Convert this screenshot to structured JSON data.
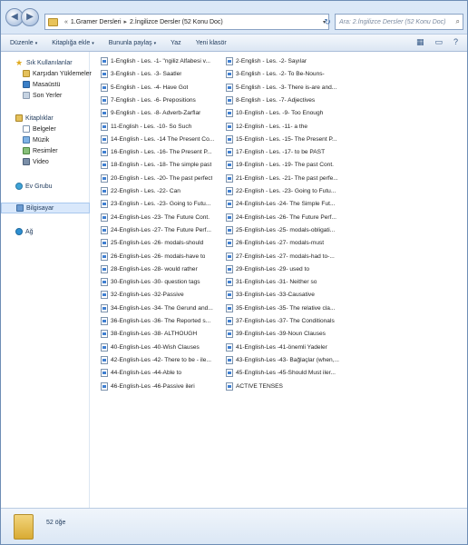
{
  "navbar": {
    "back_glyph": "◀",
    "forward_glyph": "▶",
    "address": {
      "prefix": "«",
      "crumbs": [
        "1.Gramer Dersleri",
        "2.İngilizce Dersler (52 Konu Doc)"
      ],
      "separator": "▸",
      "dropdown": "▾"
    },
    "refresh_glyph": "↻",
    "search_placeholder": "Ara: 2.İngilizce Dersler (52 Konu Doc)",
    "search_icon": "⌕"
  },
  "toolbar": {
    "items": [
      "Düzenle",
      "Kitaplığa ekle",
      "Bununla paylaş",
      "Yaz",
      "Yeni klasör"
    ],
    "arrow": "▾",
    "view_glyph": "▦",
    "pane_glyph": "▭",
    "help_glyph": "?"
  },
  "sidebar": {
    "favorites": {
      "label": "Sık Kullanılanlar",
      "items": [
        "Karşıdan Yüklemeler",
        "Masaüstü",
        "Son Yerler"
      ]
    },
    "libraries": {
      "label": "Kitaplıklar",
      "items": [
        "Belgeler",
        "Müzik",
        "Resimler",
        "Video"
      ]
    },
    "homegroup": "Ev Grubu",
    "computer": "Bilgisayar",
    "network": "Ağ"
  },
  "files": [
    "1-English - Les. -1- \"ngiliz Alfabesi v...",
    "2-English - Les. -2- Sayılar",
    "3-English - Les. -3- Saatler",
    "3-English - Les. -2- To Be-Nouns-",
    "5-English - Les. -4- Have Got",
    "5-English - Les. -3- There is-are and...",
    "7-English - Les. -6- Prepositions",
    "8-English - Les. -7- Adjectives",
    "9-English - Les. -8- Adverb-Zarflar",
    "10-English - Les. -9- Too Enough",
    "11-English - Les. -10- So Such",
    "12-English - Les. -11- a the",
    "14-English - Les. -14 The Present Co...",
    "15-English - Les. -15- The Present P...",
    "16-English - Les. -16- The Present P...",
    "17-English - Les. -17- to be PAST",
    "18-English - Les. -18- The simple past",
    "19-English - Les. -19- The past Cont.",
    "20-English - Les. -20- The past perfect",
    "21-English - Les. -21- The past perfe...",
    "22-English - Les. -22- Can",
    "22-English - Les. -23- Going to Futu...",
    "23-English - Les. -23- Going to Futu...",
    "24-English-Les -24- The Simple Fut...",
    "24-English-Les -23- The Future Cont.",
    "24-English-Les -26- The Future Perf...",
    "24-English-Les -27- The Future Perf...",
    "25-English-Les -25- modals-obligati...",
    "25-English-Les -26- modals-should",
    "26-English-Les -27- modals-must",
    "26-English-Les -26- modals-have to",
    "27-English-Les -27- modals-had to-...",
    "28-English-Les -28- would rather",
    "29-English-Les -29- used to",
    "30-English-Les -30- question tags",
    "31-English-Les -31- Neither so",
    "32-English-Les -32-Passive",
    "33-English-Les -33-Causative",
    "34-English-Les -34- The Gerund and...",
    "35-English-Les -35- The relative cla...",
    "36-English-Les -36- The Reported s...",
    "37-English-Les -37- The Conditionals",
    "38-English-Les -38- ALTHOUGH",
    "39-English-Les -39-Noun Clauses",
    "40-English-Les -40-Wish Clauses",
    "41-English-Les -41-önemli Yadeler",
    "42-English-Les -42- There to be - ile...",
    "43-English-Les -43- Bağlaçlar (when,...",
    "44-English-Les -44-Able to",
    "45-English-Les -45-Should Must iler...",
    "46-English-Les -46-Passive ileri",
    "ACTIVE TENSES"
  ],
  "details": {
    "count": "52 öğe"
  }
}
